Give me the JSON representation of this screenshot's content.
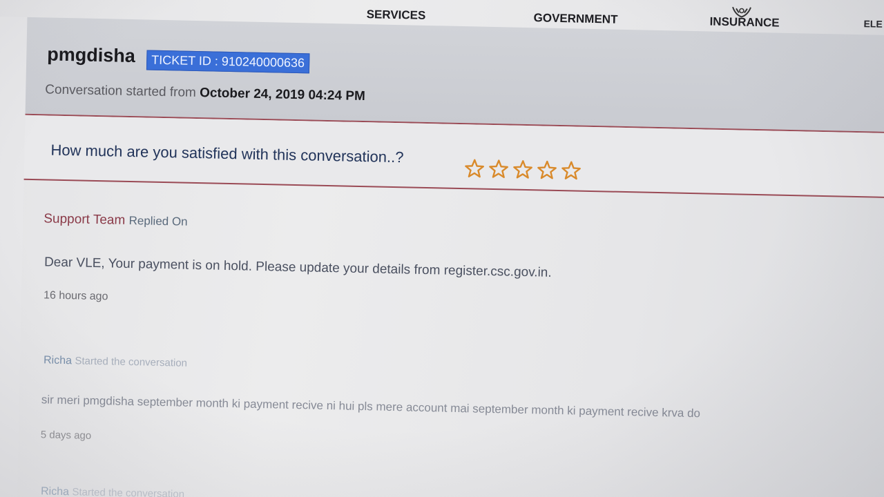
{
  "nav": {
    "items": [
      {
        "label": "SERVICES"
      },
      {
        "label": "GOVERNMENT"
      },
      {
        "label": "INSURANCE",
        "icon": "hands-icon"
      },
      {
        "label": "ELE"
      }
    ]
  },
  "ticket": {
    "title": "pmgdisha",
    "badge_label": "TICKET ID : 910240000636",
    "started_prefix": "Conversation started from",
    "started_date": "October 24, 2019 04:24 PM"
  },
  "rating": {
    "question": "How much are you satisfied with this conversation..?",
    "star_count": 5,
    "filled": 0,
    "star_color": "#d98a2b"
  },
  "messages": [
    {
      "author": "Support Team",
      "action": "Replied On",
      "text": "Dear VLE, Your payment is on hold. Please update your details from register.csc.gov.in.",
      "time": "16 hours ago"
    },
    {
      "author": "Richa",
      "action": "Started the conversation",
      "text": "sir meri pmgdisha september month ki payment recive ni hui pls mere account mai september month ki payment recive krva do",
      "time": "5 days ago"
    },
    {
      "author": "Richa",
      "action": "Started the conversation"
    }
  ],
  "colors": {
    "badge": "#3a6fd8",
    "divider": "#9a4a55",
    "support_author": "#8a3a48"
  }
}
